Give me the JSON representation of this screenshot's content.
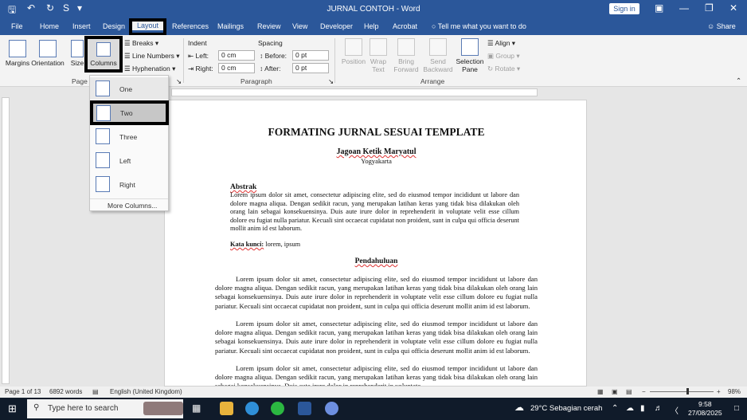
{
  "titlebar": {
    "title": "JURNAL CONTOH - Word",
    "signin": "Sign in"
  },
  "tabs": [
    "File",
    "Home",
    "Insert",
    "Design",
    "Layout",
    "References",
    "Mailings",
    "Review",
    "View",
    "Developer",
    "Help",
    "Acrobat"
  ],
  "tellme": "Tell me what you want to do",
  "share": "Share",
  "ribbon": {
    "page_setup": {
      "margins": "Margins",
      "orientation": "Orientation",
      "size": "Size",
      "columns": "Columns",
      "breaks": "Breaks",
      "line_numbers": "Line Numbers",
      "hyphenation": "Hyphenation",
      "group": "Page S"
    },
    "paragraph": {
      "indent": "Indent",
      "spacing": "Spacing",
      "left_label": "Left:",
      "left_value": "0 cm",
      "right_label": "Right:",
      "right_value": "0 cm",
      "before_label": "Before:",
      "before_value": "0 pt",
      "after_label": "After:",
      "after_value": "0 pt",
      "group": "Paragraph"
    },
    "arrange": {
      "position": "Position",
      "wrap_text": "Wrap Text",
      "bring_forward": "Bring Forward",
      "send_backward": "Send Backward",
      "selection_pane": "Selection Pane",
      "align": "Align",
      "group_btn": "Group",
      "rotate": "Rotate",
      "group": "Arrange"
    }
  },
  "columns_menu": {
    "options": [
      "One",
      "Two",
      "Three",
      "Left",
      "Right"
    ],
    "more": "More Columns..."
  },
  "document": {
    "title": "FORMATING JURNAL SESUAI TEMPLATE",
    "author": "Jagoan Ketik Maryatul",
    "city": "Yogyakarta",
    "abstract_heading": "Abstrak",
    "abstract": "Lorem ipsum dolor sit amet, consectetur adipiscing elite, sed do eiusmod tempor incididunt ut labore dan dolore magna aliqua. Dengan sedikit racun, yang merupakan latihan keras yang tidak bisa dilakukan oleh orang lain sebagai konsekuensinya. Duis aute irure dolor in reprehenderit in voluptate velit esse cillum dolore eu fugiat nulla pariatur. Kecuali sint occaecat cupidatat non proident, sunt in culpa qui officia deserunt mollit anim id est laborum.",
    "keywords_label": "Kata kunci:",
    "keywords": " lorem, ipsum",
    "section_heading": "Pendahuluan",
    "paragraph1": "Lorem ipsum dolor sit amet, consectetur adipiscing elite, sed do eiusmod tempor incididunt ut labore dan dolore magna aliqua. Dengan sedikit racun, yang merupakan latihan keras yang tidak bisa dilakukan oleh orang lain sebagai konsekuensinya. Duis aute irure dolor in reprehenderit in voluptate velit esse cillum dolore eu fugiat nulla pariatur. Kecuali sint occaecat cupidatat non proident, sunt in culpa qui officia deserunt mollit anim id est laborum.",
    "paragraph2": "Lorem ipsum dolor sit amet, consectetur adipiscing elite, sed do eiusmod tempor incididunt ut labore dan dolore magna aliqua. Dengan sedikit racun, yang merupakan latihan keras yang tidak bisa dilakukan oleh orang lain sebagai konsekuensinya. Duis aute irure dolor in reprehenderit in voluptate velit esse cillum dolore eu fugiat nulla pariatur. Kecuali sint occaecat cupidatat non proident, sunt in culpa qui officia deserunt mollit anim id est laborum.",
    "paragraph3": "Lorem ipsum dolor sit amet, consectetur adipiscing elite, sed do eiusmod tempor incididunt ut labore dan dolore magna aliqua. Dengan sedikit racun, yang merupakan latihan keras yang tidak bisa dilakukan oleh orang lain sebagai konsekuensinya. Duis aute irure dolor in reprehenderit in voluptate"
  },
  "status": {
    "page": "Page 1 of 13",
    "words": "6892 words",
    "language": "English (United Kingdom)",
    "zoom": "98%"
  },
  "taskbar": {
    "search": "Type here to search",
    "weather": "29°C  Sebagian cerah",
    "time": "9:58",
    "date": "27/08/2025"
  },
  "colors": {
    "word_blue": "#2b579a",
    "highlight_border": "#000000"
  }
}
